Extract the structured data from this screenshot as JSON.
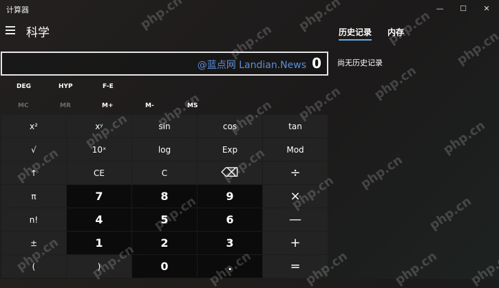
{
  "window": {
    "title": "计算器",
    "minimize": "—",
    "maximize": "☐",
    "close": "✕"
  },
  "header": {
    "mode": "科学"
  },
  "tabs": [
    {
      "label": "历史记录"
    },
    {
      "label": "内存"
    }
  ],
  "history": {
    "empty_text": "尚无历史记录"
  },
  "display": {
    "overlay": "@蓝点网 Landian.News",
    "value": "0"
  },
  "toggles": {
    "angle": "DEG",
    "hyp": "HYP",
    "fe": "F-E"
  },
  "memory": [
    "MC",
    "MR",
    "M+",
    "M-",
    "MS"
  ],
  "keys": [
    [
      "x²",
      "xʸ",
      "sin",
      "cos",
      "tan"
    ],
    [
      "√",
      "10ˣ",
      "log",
      "Exp",
      "Mod"
    ],
    [
      "↑",
      "CE",
      "C",
      "⌫",
      "÷"
    ],
    [
      "π",
      "7",
      "8",
      "9",
      "×"
    ],
    [
      "n!",
      "4",
      "5",
      "6",
      "—"
    ],
    [
      "±",
      "1",
      "2",
      "3",
      "+"
    ],
    [
      "(",
      ")",
      "0",
      ".",
      "="
    ]
  ],
  "watermark": "php.cn"
}
